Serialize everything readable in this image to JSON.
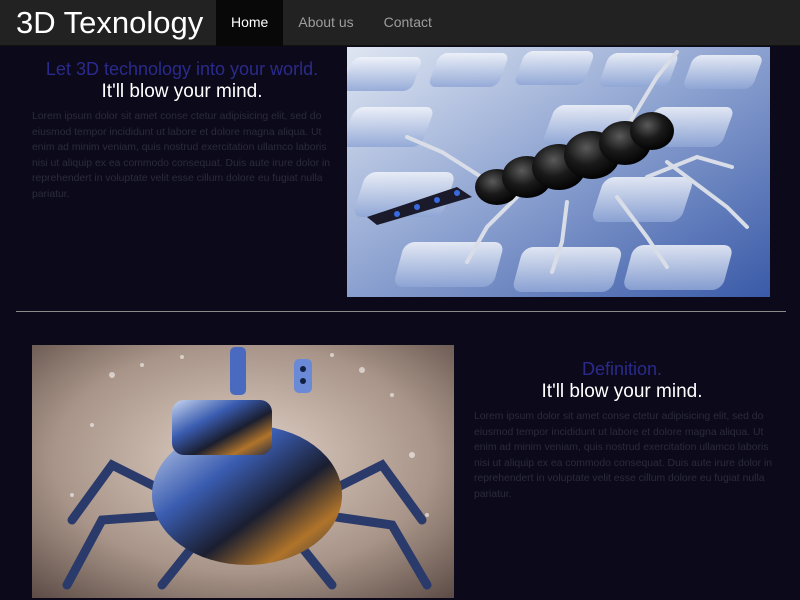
{
  "navbar": {
    "brand": "3D Texnology",
    "items": [
      {
        "label": "Home",
        "active": true
      },
      {
        "label": "About us",
        "active": false
      },
      {
        "label": "Contact",
        "active": false
      }
    ]
  },
  "section1": {
    "heading": "Let 3D technology into your world.",
    "subheading": "It'll blow your mind.",
    "body": "Lorem ipsum dolor sit amet conse ctetur adipisicing elit, sed do eiusmod tempor incididunt ut labore et dolore magna aliqua. Ut enim ad minim veniam, quis nostrud exercitation ullamco laboris nisi ut aliquip ex ea commodo consequat. Duis aute irure dolor in reprehendert in voluptate velit esse cillum dolore eu fugiat nulla pariatur.",
    "image_icon": "robot-insect-image"
  },
  "section2": {
    "heading": "Definition.",
    "subheading": "It'll blow your mind.",
    "body": "Lorem ipsum dolor sit amet conse ctetur adipisicing elit, sed do eiusmod tempor incididunt ut labore et dolore magna aliqua. Ut enim ad minim veniam, quis nostrud exercitation ullamco laboris nisi ut aliquip ex ea commodo consequat. Duis aute irure dolor in reprehendert in voluptate velit esse cillum dolore eu fugiat nulla pariatur.",
    "image_icon": "robot-crab-image"
  },
  "colors": {
    "background": "#0c0a1a",
    "navbar": "#222222",
    "accent_heading": "#2a2a8c",
    "body_text": "#2b2b3a"
  }
}
